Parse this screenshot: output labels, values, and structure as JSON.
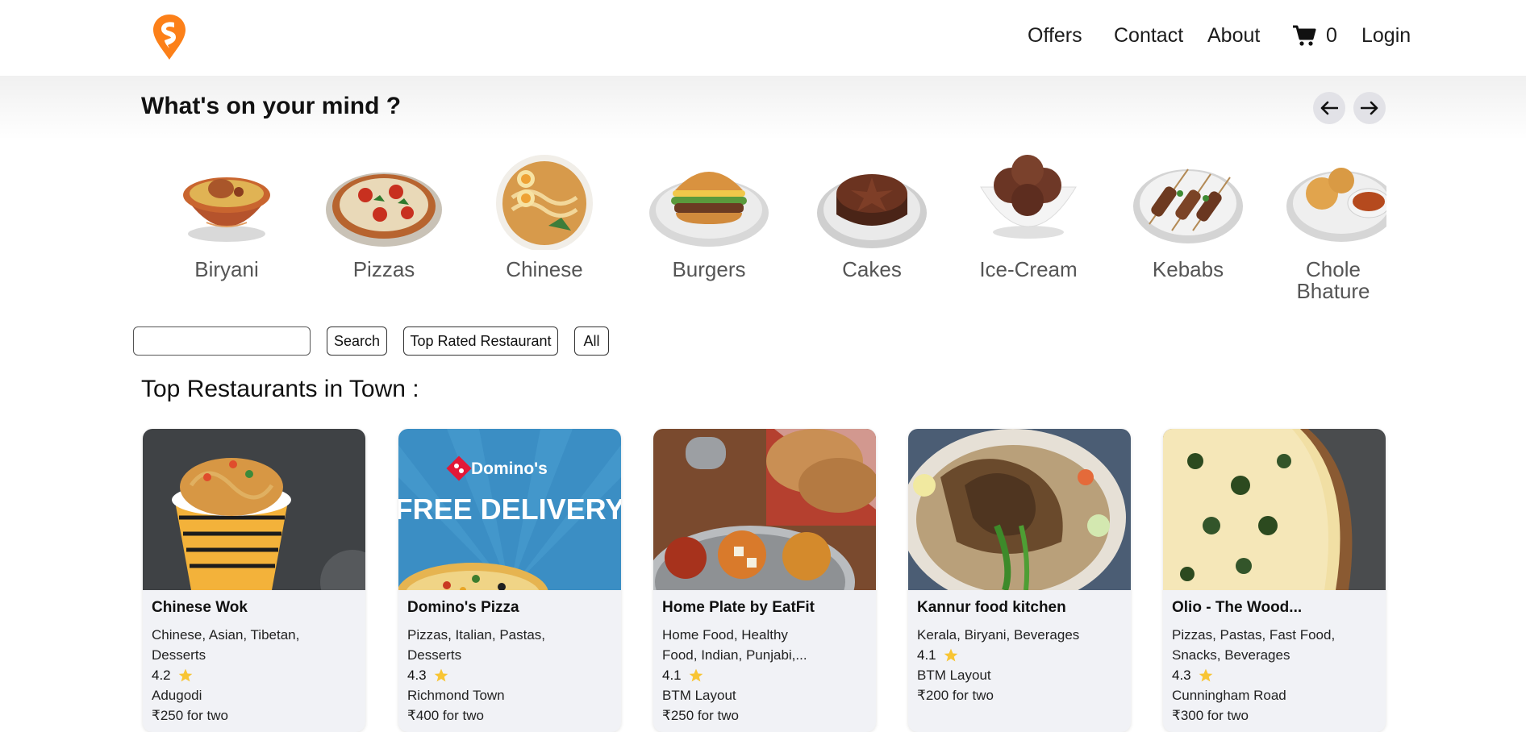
{
  "header": {
    "nav": {
      "offers": "Offers",
      "contact": "Contact",
      "about": "About",
      "cart_count": "0",
      "login": "Login"
    },
    "brand_color": "#fc8019"
  },
  "mind": {
    "title": "What's on your mind ?",
    "categories": [
      {
        "label": "Biryani",
        "icon": "biryani-bowl"
      },
      {
        "label": "Pizzas",
        "icon": "pizza"
      },
      {
        "label": "Chinese",
        "icon": "noodle-bowl"
      },
      {
        "label": "Burgers",
        "icon": "burger"
      },
      {
        "label": "Cakes",
        "icon": "chocolate-cake"
      },
      {
        "label": "Ice-Cream",
        "icon": "ice-cream-bowl"
      },
      {
        "label": "Kebabs",
        "icon": "kebab-plate"
      },
      {
        "label": "Chole Bhature",
        "icon": "chole-bhature"
      }
    ]
  },
  "filters": {
    "search_placeholder": "",
    "search_label": "Search",
    "top_rated_label": "Top Rated Restaurant",
    "all_label": "All"
  },
  "restaurants_title": "Top Restaurants in Town :",
  "restaurants": [
    {
      "name": "Chinese Wok",
      "cuisines": [
        "Chinese, Asian, Tibetan,",
        "Desserts"
      ],
      "rating": "4.2",
      "area": "Adugodi",
      "cost": "₹250 for two"
    },
    {
      "name": "Domino's Pizza",
      "cuisines": [
        "Pizzas, Italian, Pastas,",
        "Desserts"
      ],
      "rating": "4.3",
      "area": "Richmond Town",
      "cost": "₹400 for two",
      "image_text": {
        "brand": "Domino's",
        "banner": "FREE DELIVERY"
      }
    },
    {
      "name": "Home Plate by EatFit",
      "cuisines": [
        "Home Food, Healthy",
        "Food, Indian, Punjabi,..."
      ],
      "rating": "4.1",
      "area": "BTM Layout",
      "cost": "₹250 for two"
    },
    {
      "name": "Kannur food kitchen",
      "cuisines": [
        "Kerala, Biryani, Beverages"
      ],
      "rating": "4.1",
      "area": "BTM Layout",
      "cost": "₹200 for two"
    },
    {
      "name": "Olio - The Wood...",
      "cuisines": [
        "Pizzas, Pastas, Fast Food,",
        "Snacks, Beverages"
      ],
      "rating": "4.3",
      "area": "Cunningham Road",
      "cost": "₹300 for two"
    }
  ]
}
